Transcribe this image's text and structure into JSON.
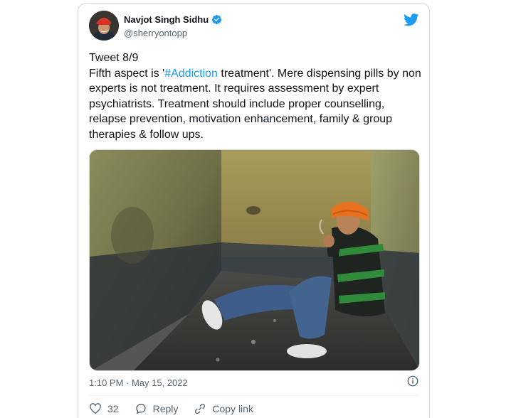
{
  "author": {
    "name": "Navjot Singh Sidhu",
    "handle": "@sherryontopp"
  },
  "tweet": {
    "text_before": "Tweet 8/9\nFifth aspect is '",
    "hashtag": "#Addiction",
    "text_after": " treatment'. Mere dispensing pills by non experts is not treatment. It requires assessment by expert psychiatrists. Treatment should include proper counselling, relapse prevention, motivation enhancement, family & group therapies & follow ups.",
    "timestamp": "1:10 PM · May 15, 2022"
  },
  "actions": {
    "like_count": "32",
    "reply_label": "Reply",
    "copy_label": "Copy link"
  },
  "colors": {
    "accent": "#1d9bf0",
    "secondary_text": "#536471",
    "border": "#cfd9de"
  }
}
